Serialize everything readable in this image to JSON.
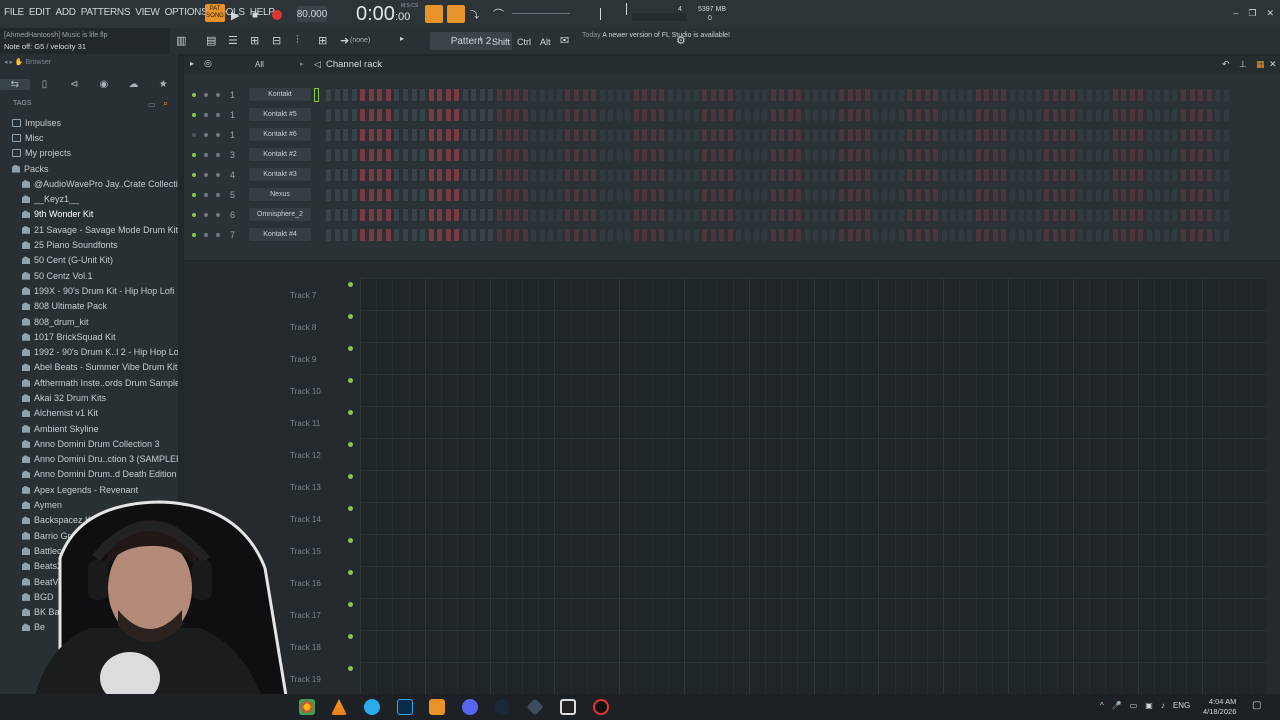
{
  "menu": [
    "FILE",
    "EDIT",
    "ADD",
    "PATTERNS",
    "VIEW",
    "OPTIONS",
    "TOOLS",
    "HELP"
  ],
  "transport": {
    "pat_label": "PAT",
    "song_label": "SONG",
    "tempo": "80.000",
    "time": "0:00",
    "time_small": ":00",
    "time_unit": "M:S:CS"
  },
  "cpu": {
    "line1": "4",
    "line2": "5397 MB",
    "line3": "0"
  },
  "hint": {
    "line1": "[AhmedHantoosh] Music is life.flp",
    "line2": "Note off: G5 / velocity 31"
  },
  "toolbar": {
    "pattern_none": "(none)",
    "pattern": "Pattern 2",
    "shift": "Shift",
    "ctrl": "Ctrl",
    "alt": "Alt",
    "news_today": "Today",
    "news_text": "A newer version of FL Studio is available!"
  },
  "browser": {
    "title": "Browser",
    "tags": "TAGS",
    "items": [
      {
        "label": "Impulses",
        "type": "folder",
        "level": 0
      },
      {
        "label": "Misc",
        "type": "folder",
        "level": 0
      },
      {
        "label": "My projects",
        "type": "folder",
        "level": 0
      },
      {
        "label": "Packs",
        "type": "pack",
        "level": 0
      },
      {
        "label": "@AudioWavePro Jay..Crate Collection",
        "type": "pack",
        "level": 1
      },
      {
        "label": "__Keyz1__",
        "type": "pack",
        "level": 1
      },
      {
        "label": "9th Wonder Kit",
        "type": "pack",
        "level": 1,
        "selected": true
      },
      {
        "label": "21 Savage - Savage Mode Drum Kit",
        "type": "pack",
        "level": 1
      },
      {
        "label": "25 Piano Soundfonts",
        "type": "pack",
        "level": 1
      },
      {
        "label": "50 Cent (G-Unit Kit)",
        "type": "pack",
        "level": 1
      },
      {
        "label": "50 Centz Vol.1",
        "type": "pack",
        "level": 1
      },
      {
        "label": "199X - 90's Drum Kit - Hip Hop Lofi",
        "type": "pack",
        "level": 1
      },
      {
        "label": "808 Ultimate Pack",
        "type": "pack",
        "level": 1
      },
      {
        "label": "808_drum_kit",
        "type": "pack",
        "level": 1
      },
      {
        "label": "1017 BrickSquad Kit",
        "type": "pack",
        "level": 1
      },
      {
        "label": "1992 - 90's Drum K..l 2 - Hip Hop Lofi",
        "type": "pack",
        "level": 1
      },
      {
        "label": "Abel Beats - Summer Vibe Drum Kit",
        "type": "pack",
        "level": 1
      },
      {
        "label": "Afthermath Inste..ords Drum Samples",
        "type": "pack",
        "level": 1
      },
      {
        "label": "Akai 32 Drum Kits",
        "type": "pack",
        "level": 1
      },
      {
        "label": "Alchemist v1 Kit",
        "type": "pack",
        "level": 1
      },
      {
        "label": "Ambient Skyline",
        "type": "pack",
        "level": 1
      },
      {
        "label": "Anno Domini Drum Collection 3",
        "type": "pack",
        "level": 1
      },
      {
        "label": "Anno Domini Dru..ction 3 (SAMPLER)",
        "type": "pack",
        "level": 1
      },
      {
        "label": "Anno Domini Drum..d Death Edition 3",
        "type": "pack",
        "level": 1
      },
      {
        "label": "Apex Legends - Revenant",
        "type": "pack",
        "level": 1
      },
      {
        "label": "Aymen",
        "type": "pack",
        "level": 1
      },
      {
        "label": "Backspacez Kit Vol",
        "type": "pack",
        "level": 1
      },
      {
        "label": "Barrio Groove",
        "type": "pack",
        "level": 1
      },
      {
        "label": "Battlecat Kit",
        "type": "pack",
        "level": 1
      },
      {
        "label": "Beats24-7.co",
        "type": "pack",
        "level": 1
      },
      {
        "label": "BeatVox Dri",
        "type": "pack",
        "level": 1
      },
      {
        "label": "BGD",
        "type": "pack",
        "level": 1
      },
      {
        "label": "BK Ba",
        "type": "pack",
        "level": 1
      },
      {
        "label": "Be",
        "type": "pack",
        "level": 1
      }
    ]
  },
  "rack": {
    "title": "Channel rack",
    "filter": "All",
    "channels": [
      {
        "num": "1",
        "name": "Kontakt"
      },
      {
        "num": "1",
        "name": "Kontakt #5"
      },
      {
        "num": "1",
        "name": "Kontakt #6"
      },
      {
        "num": "3",
        "name": "Kontakt #2"
      },
      {
        "num": "4",
        "name": "Kontakt #3"
      },
      {
        "num": "5",
        "name": "Nexus"
      },
      {
        "num": "6",
        "name": "Omnisphere_2"
      },
      {
        "num": "7",
        "name": "Kontakt #4"
      }
    ]
  },
  "playlist": {
    "tracks": [
      "Track 7",
      "Track 8",
      "Track 9",
      "Track 10",
      "Track 11",
      "Track 12",
      "Track 13",
      "Track 14",
      "Track 15",
      "Track 16",
      "Track 17",
      "Track 18",
      "Track 19"
    ]
  },
  "taskbar": {
    "lang": "ENG",
    "time": "4:04 AM",
    "date": "4/18/2026"
  },
  "colors": {
    "accent": "#e8922a",
    "step_red": "#7a3a44",
    "step_dark": "#39444a",
    "led_green": "#8bc34a"
  }
}
